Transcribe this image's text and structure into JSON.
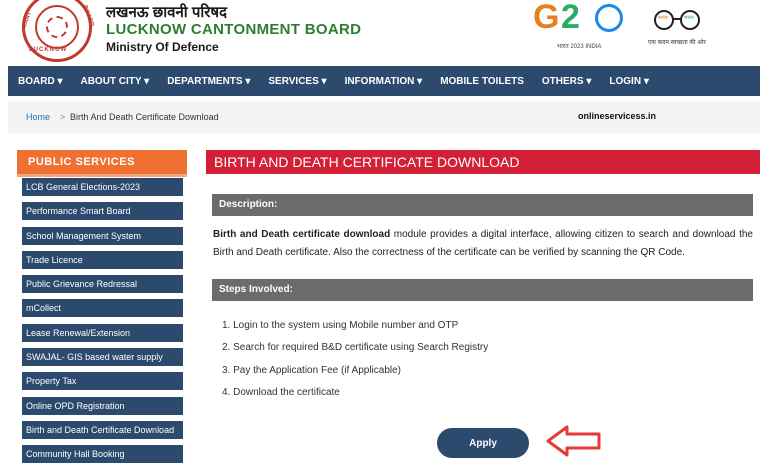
{
  "header": {
    "hindi_name": "लखनऊ छावनी परिषद",
    "org_name": "LUCKNOW CANTONMENT BOARD",
    "ministry": "Ministry Of Defence",
    "logo_text_top": "CANT",
    "logo_text_right": "BOARD",
    "logo_text_bottom": "LUCKNOW",
    "g20_sub": "भारत 2023 INDIA",
    "swachh_left": "स्वच्छ",
    "swachh_right": "भारत",
    "swachh_tagline": "एक कदम स्वच्छता की ओर"
  },
  "nav": {
    "items": [
      "BOARD ▾",
      "ABOUT CITY ▾",
      "DEPARTMENTS ▾",
      "SERVICES ▾",
      "INFORMATION ▾",
      "MOBILE TOILETS",
      "OTHERS ▾",
      "LOGIN ▾"
    ]
  },
  "breadcrumb": {
    "home": "Home",
    "separator": ">",
    "current": "Birth And Death Certificate Download",
    "site": "onlineservicess.in"
  },
  "sidebar": {
    "heading": "PUBLIC SERVICES",
    "items": [
      "LCB General Elections-2023",
      "Performance Smart Board",
      "School Management System",
      "Trade Licence",
      "Public Grievance Redressal",
      "mCollect",
      "Lease Renewal/Extension",
      "SWAJAL- GIS based water supply",
      "Property Tax",
      "Online OPD Registration",
      "Birth and Death Certificate Download",
      "Community Hall Booking"
    ]
  },
  "main": {
    "title": "BIRTH AND DEATH CERTIFICATE DOWNLOAD",
    "description_heading": "Description:",
    "description_bold": "Birth and Death certificate download",
    "description_rest": " module provides a digital interface, allowing citizen to search and download the Birth and Death certificate. Also the correctness of the certificate can be verified by scanning the QR Code.",
    "steps_heading": "Steps Involved:",
    "steps": [
      "1. Login to the system using Mobile number and OTP",
      "2. Search for required B&D certificate using Search Registry",
      "3. Pay the Application Fee (if Applicable)",
      "4. Download the certificate"
    ],
    "apply_label": "Apply"
  },
  "colors": {
    "nav_bg": "#2b4a6e",
    "title_red": "#d32036",
    "sidebar_orange": "#ef7030",
    "section_grey": "#6b6b6b",
    "arrow_red": "#e53935",
    "org_green": "#2e7d32"
  },
  "icons": {
    "apply_pointer": "left-arrow-icon",
    "emblem": "cantonment-emblem-icon",
    "g20": "g20-logo-icon",
    "swachh": "swachh-bharat-glasses-icon"
  }
}
